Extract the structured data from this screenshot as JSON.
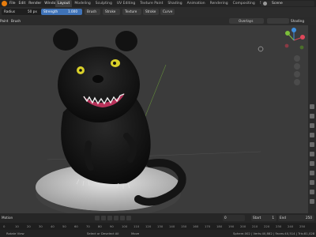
{
  "topbar": {
    "menus": [
      "File",
      "Edit",
      "Render",
      "Window",
      "Help"
    ],
    "tabs": [
      "Layout",
      "Modeling",
      "Sculpting",
      "UV Editing",
      "Texture Paint",
      "Shading",
      "Animation",
      "Rendering",
      "Compositing",
      "Scripting"
    ],
    "scene": "Scene"
  },
  "toolbar": {
    "radius_label": "Radius",
    "radius_value": "50 px",
    "strength_label": "Strength",
    "strength_value": "1.000",
    "brush": "Brush",
    "stroke": "Stroke",
    "texture": "Texture",
    "curve": "Curve"
  },
  "header": {
    "mode": "Paint",
    "brush_menu": "Brush",
    "overlays": "Overlays",
    "shading": "Shading"
  },
  "timeline": {
    "frame_current": "0",
    "start_label": "Start",
    "start_value": "1",
    "end_label": "End",
    "end_value": "250"
  },
  "frames": [
    "0",
    "10",
    "20",
    "30",
    "40",
    "50",
    "60",
    "70",
    "80",
    "90",
    "100",
    "110",
    "120",
    "130",
    "140",
    "150",
    "160",
    "170",
    "180",
    "190",
    "200",
    "210",
    "220",
    "230",
    "240",
    "250"
  ],
  "status": {
    "left": "Rotate View",
    "middle1": "Select or Deselect All",
    "middle2": "Move",
    "right": "Sphere.002 | Verts:40,882 | Faces:40,514 | Tris:81,028 | Objects:0/3"
  },
  "colors": {
    "accent_blue": "#3f73b8",
    "axis_x": "#e0485a",
    "axis_y": "#7cbf3a",
    "axis_z": "#3d8fe0",
    "blender_orange": "#e87d0d"
  }
}
